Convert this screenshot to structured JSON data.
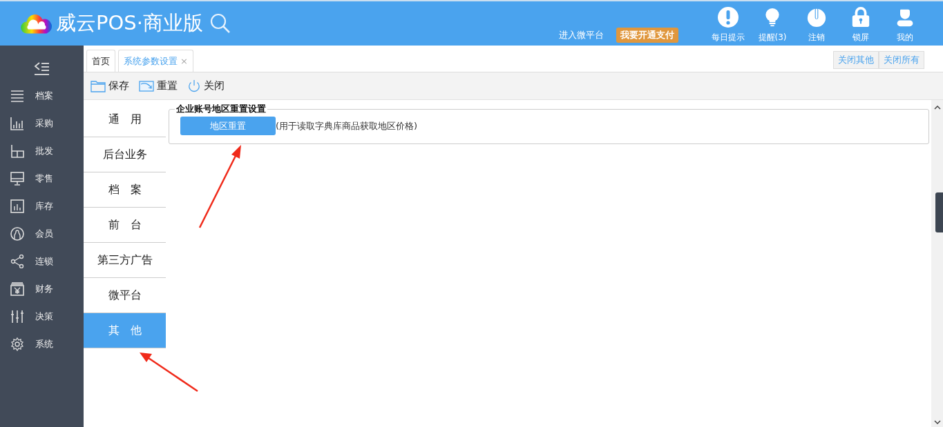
{
  "header": {
    "title": "威云POS·商业版",
    "links": [
      {
        "label": "进入微平台",
        "kind": "link"
      },
      {
        "label": "我要开通支付",
        "kind": "badge"
      }
    ],
    "actions": [
      {
        "kind": "exclamation",
        "label": "每日提示"
      },
      {
        "kind": "bulb",
        "label": "提醒(3)"
      },
      {
        "kind": "power",
        "label": "注销"
      },
      {
        "kind": "lock",
        "label": "锁屏"
      },
      {
        "kind": "user",
        "label": "我的"
      }
    ]
  },
  "sidebar": {
    "items": [
      {
        "kind": "lines",
        "label": "档案"
      },
      {
        "kind": "bars",
        "label": "采购"
      },
      {
        "kind": "blocks",
        "label": "批发"
      },
      {
        "kind": "monitor",
        "label": "零售"
      },
      {
        "kind": "chart",
        "label": "库存"
      },
      {
        "kind": "member",
        "label": "会员"
      },
      {
        "kind": "share",
        "label": "连锁"
      },
      {
        "kind": "yen",
        "label": "财务"
      },
      {
        "kind": "sliders",
        "label": "决策"
      },
      {
        "kind": "gear",
        "label": "系统"
      }
    ]
  },
  "tabs": [
    {
      "label": "首页",
      "selected": false
    },
    {
      "label": "系统参数设置",
      "selected": true,
      "close": "×"
    }
  ],
  "tab_actions": [
    "关闭其他",
    "关闭所有"
  ],
  "toolbar": [
    {
      "kind": "folder",
      "label": "保存"
    },
    {
      "kind": "image",
      "label": "重置"
    },
    {
      "kind": "power",
      "label": "关闭"
    }
  ],
  "settings_nav": [
    {
      "label": "通　用",
      "selected": false
    },
    {
      "label": "后台业务",
      "selected": false
    },
    {
      "label": "档　案",
      "selected": false
    },
    {
      "label": "前　台",
      "selected": false
    },
    {
      "label": "第三方广告",
      "selected": false
    },
    {
      "label": "微平台",
      "selected": false
    },
    {
      "label": "其　他",
      "selected": true
    }
  ],
  "section": {
    "legend": "企业账号地区重置设置",
    "button": "地区重置",
    "note": "(用于读取字典库商品获取地区价格)"
  }
}
